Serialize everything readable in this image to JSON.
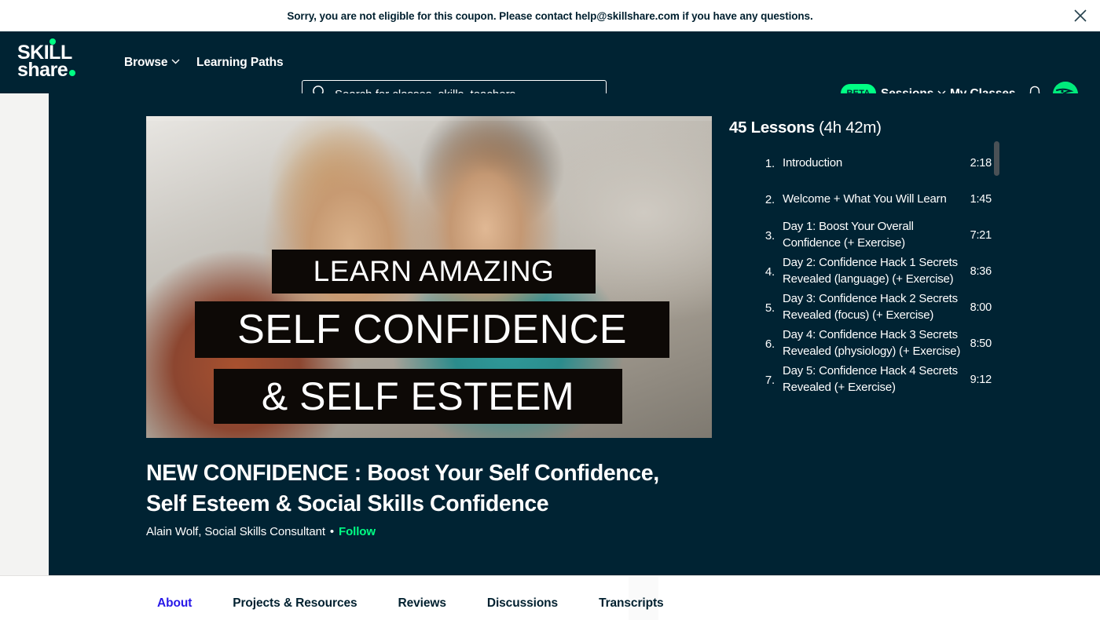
{
  "banner": {
    "message": "Sorry, you are not eligible for this coupon. Please contact help@skillshare.com if you have any questions.",
    "close_label": "close-icon"
  },
  "nav": {
    "logo_line1": "SKILL",
    "logo_line2": "share",
    "browse": "Browse",
    "learning_paths": "Learning Paths",
    "beta": "BETA",
    "sessions": "Sessions",
    "my_classes": "My Classes"
  },
  "search": {
    "placeholder": "Search for classes, skills, teachers",
    "value": ""
  },
  "video": {
    "caption_line1": "LEARN AMAZING",
    "caption_line2": "SELF CONFIDENCE",
    "caption_line3": "& SELF ESTEEM"
  },
  "course": {
    "title": "NEW CONFIDENCE : Boost Your Self Confidence, Self Esteem & Social Skills Confidence",
    "author": "Alain Wolf, Social Skills Consultant",
    "separator": "•",
    "follow": "Follow"
  },
  "lessons_panel": {
    "count_label": "45 Lessons",
    "duration_label": "(4h 42m)",
    "items": [
      {
        "num": "1.",
        "title": "Introduction",
        "time": "2:18"
      },
      {
        "num": "2.",
        "title": "Welcome + What You Will Learn",
        "time": "1:45"
      },
      {
        "num": "3.",
        "title": "Day 1: Boost Your Overall Confidence (+ Exercise)",
        "time": "7:21"
      },
      {
        "num": "4.",
        "title": "Day 2: Confidence Hack 1 Secrets Revealed (language) (+ Exercise)",
        "time": "8:36"
      },
      {
        "num": "5.",
        "title": "Day 3: Confidence Hack 2 Secrets Revealed (focus) (+ Exercise)",
        "time": "8:00"
      },
      {
        "num": "6.",
        "title": "Day 4: Confidence Hack 3 Secrets Revealed (physiology) (+ Exercise)",
        "time": "8:50"
      },
      {
        "num": "7.",
        "title": "Day 5: Confidence Hack 4 Secrets Revealed (+ Exercise)",
        "time": "9:12"
      }
    ]
  },
  "tabs": [
    {
      "label": "About",
      "active": true
    },
    {
      "label": "Projects & Resources",
      "active": false
    },
    {
      "label": "Reviews",
      "active": false
    },
    {
      "label": "Discussions",
      "active": false
    },
    {
      "label": "Transcripts",
      "active": false
    }
  ],
  "colors": {
    "navy": "#002333",
    "green": "#00ff84",
    "accent_blue": "#2818e8",
    "page_gray": "#f3f3f2"
  }
}
